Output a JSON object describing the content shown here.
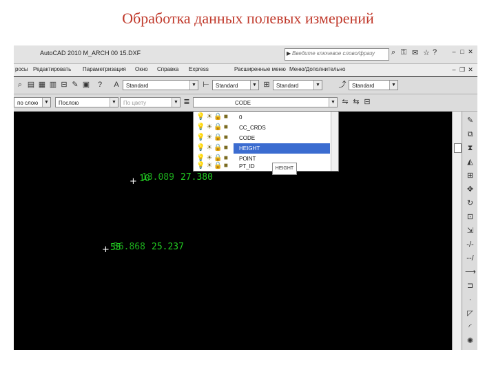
{
  "slide": {
    "title": "Обработка данных полевых измерений"
  },
  "window": {
    "title": "AutoCAD 2010   M_ARCH 00 15.DXF",
    "search_placeholder": "Введите ключевое слово/фразу"
  },
  "menu": [
    "росы",
    "Редактировать",
    "Параметризация",
    "Окно",
    "Справка",
    "Express",
    "Расширенные меню",
    "Меню/Дополнительно"
  ],
  "toolbar2": {
    "text_style": "Standard",
    "dim_style": "Standard",
    "table_style": "Standard",
    "multileader_style": "Standard"
  },
  "toolbar3": {
    "color": "по слою",
    "linetype": "Послою",
    "lineweight": "По цвету",
    "current_layer": "CODE"
  },
  "layers": [
    {
      "name": "0",
      "selected": false
    },
    {
      "name": "CC_CRDS",
      "selected": false
    },
    {
      "name": "CODE",
      "selected": false
    },
    {
      "name": "HEIGHT",
      "selected": true
    },
    {
      "name": "POINT",
      "selected": false
    },
    {
      "name": "PT_ID",
      "selected": false
    }
  ],
  "tooltip": "HEIGHT",
  "canvas": {
    "label1_id": "10",
    "label1_height": "13.089",
    "label1_code": "27.380",
    "label2_id": "55",
    "label2_height": "56.868",
    "label2_code": "25.237"
  },
  "icons": {
    "layer_row": [
      "lightbulb-icon",
      "sun-icon",
      "lock-icon",
      "color-square-icon"
    ]
  }
}
